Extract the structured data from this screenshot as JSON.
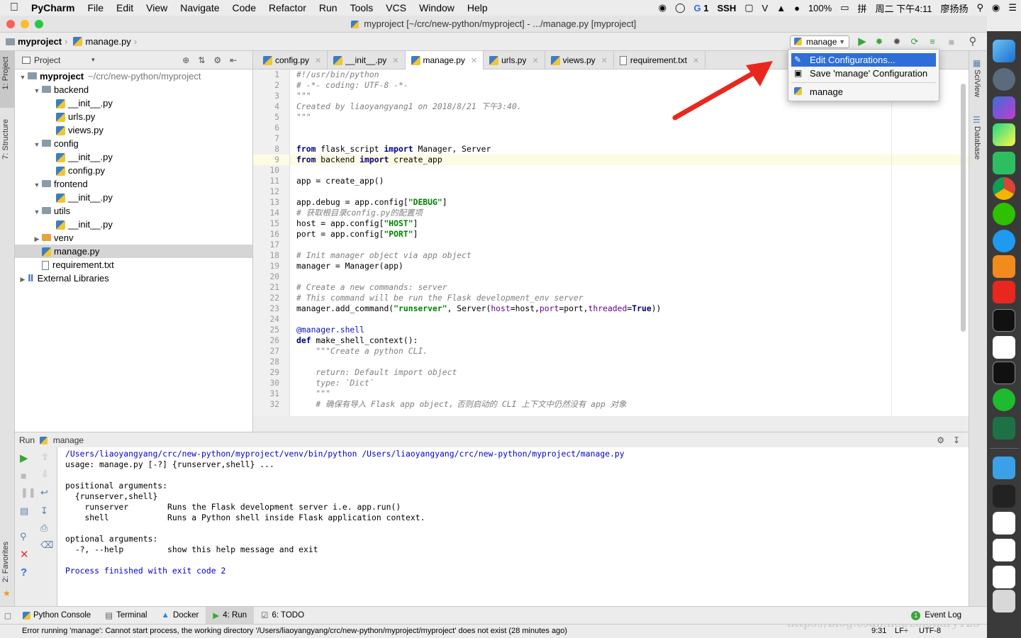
{
  "menubar": {
    "app": "PyCharm",
    "items": [
      "File",
      "Edit",
      "View",
      "Navigate",
      "Code",
      "Refactor",
      "Run",
      "Tools",
      "VCS",
      "Window",
      "Help"
    ],
    "status_items": [
      "1",
      "SSH",
      "100%",
      "周二 下午4:11",
      "廖扬扬"
    ]
  },
  "window_title": "myproject [~/crc/new-python/myproject] - .../manage.py [myproject]",
  "breadcrumb": {
    "project": "myproject",
    "file": "manage.py"
  },
  "run_config": {
    "selected": "manage"
  },
  "popup": {
    "items": [
      {
        "label": "Edit Configurations...",
        "selected": true
      },
      {
        "label": "Save 'manage' Configuration",
        "selected": false
      },
      {
        "label": "manage",
        "selected": false
      }
    ]
  },
  "left_stripe": {
    "project_tab": "1: Project",
    "structure_tab": "7: Structure",
    "favorites_tab": "2: Favorites"
  },
  "right_stripe": {
    "sciview_tab": "SciView",
    "database_tab": "Database"
  },
  "project_panel": {
    "header": "Project",
    "tree": [
      {
        "label": "myproject",
        "note": "~/crc/new-python/myproject",
        "type": "folder",
        "depth": 0,
        "expanded": true,
        "bold": true
      },
      {
        "label": "backend",
        "type": "folder",
        "depth": 1,
        "expanded": true
      },
      {
        "label": "__init__.py",
        "type": "py",
        "depth": 2
      },
      {
        "label": "urls.py",
        "type": "py",
        "depth": 2
      },
      {
        "label": "views.py",
        "type": "py",
        "depth": 2
      },
      {
        "label": "config",
        "type": "folder",
        "depth": 1,
        "expanded": true
      },
      {
        "label": "__init__.py",
        "type": "py",
        "depth": 2
      },
      {
        "label": "config.py",
        "type": "py",
        "depth": 2
      },
      {
        "label": "frontend",
        "type": "folder",
        "depth": 1,
        "expanded": true
      },
      {
        "label": "__init__.py",
        "type": "py",
        "depth": 2
      },
      {
        "label": "utils",
        "type": "folder",
        "depth": 1,
        "expanded": true
      },
      {
        "label": "__init__.py",
        "type": "py",
        "depth": 2
      },
      {
        "label": "venv",
        "type": "venv",
        "depth": 1,
        "expanded": false
      },
      {
        "label": "manage.py",
        "type": "py",
        "depth": 1,
        "selected": true
      },
      {
        "label": "requirement.txt",
        "type": "txt",
        "depth": 1
      },
      {
        "label": "External Libraries",
        "type": "lib",
        "depth": 0,
        "expanded": false
      }
    ]
  },
  "editor_tabs": [
    {
      "label": "config.py",
      "active": false
    },
    {
      "label": "__init__.py",
      "active": false
    },
    {
      "label": "manage.py",
      "active": true
    },
    {
      "label": "urls.py",
      "active": false
    },
    {
      "label": "views.py",
      "active": false
    },
    {
      "label": "requirement.txt",
      "active": false
    }
  ],
  "code_lines": [
    "#!/usr/bin/python",
    "# -*- coding: UTF-8 -*-",
    "\"\"\"",
    "Created by liaoyangyang1 on 2018/8/21 下午3:40.",
    "\"\"\"",
    "",
    "",
    "from flask_script import Manager, Server",
    "from backend import create_app",
    "",
    "app = create_app()",
    "",
    "app.debug = app.config[\"DEBUG\"]",
    "# 获取根目录config.py的配置项",
    "host = app.config[\"HOST\"]",
    "port = app.config[\"PORT\"]",
    "",
    "# Init manager object via app object",
    "manager = Manager(app)",
    "",
    "# Create a new commands: server",
    "# This command will be run the Flask development_env server",
    "manager.add_command(\"runserver\", Server(host=host,port=port,threaded=True))",
    "",
    "@manager.shell",
    "def make_shell_context():",
    "    \"\"\"Create a python CLI.",
    "",
    "    return: Default import object",
    "    type: `Dict`",
    "    \"\"\"",
    "    # 确保有导入 Flask app object，否则启动的 CLI 上下文中仍然没有 app 对象"
  ],
  "run_panel": {
    "title": "Run",
    "config": "manage",
    "output": [
      "/Users/liaoyangyang/crc/new-python/myproject/venv/bin/python /Users/liaoyangyang/crc/new-python/myproject/manage.py",
      "usage: manage.py [-?] {runserver,shell} ...",
      "",
      "positional arguments:",
      "  {runserver,shell}",
      "    runserver        Runs the Flask development server i.e. app.run()",
      "    shell            Runs a Python shell inside Flask application context.",
      "",
      "optional arguments:",
      "  -?, --help         show this help message and exit",
      "",
      "Process finished with exit code 2"
    ]
  },
  "bottom_tools": [
    {
      "label": "Python Console",
      "active": false
    },
    {
      "label": "Terminal",
      "active": false
    },
    {
      "label": "Docker",
      "active": false
    },
    {
      "label": "4: Run",
      "active": true
    },
    {
      "label": "6: TODO",
      "active": false
    }
  ],
  "event_log": {
    "count": "1",
    "label": "Event Log"
  },
  "status": {
    "message": "Error running 'manage': Cannot start process, the working directory '/Users/liaoyangyang/crc/new-python/myproject/myproject' does not exist (28 minutes ago)",
    "position": "9:31",
    "line_sep": "LF÷",
    "encoding": "UTF-8",
    "watermark": "https://blog.csdn.net/zolohary123"
  },
  "colors": {
    "accent": "#2f6ed7",
    "arrow": "#e8281e",
    "run_green": "#3aa53a"
  }
}
